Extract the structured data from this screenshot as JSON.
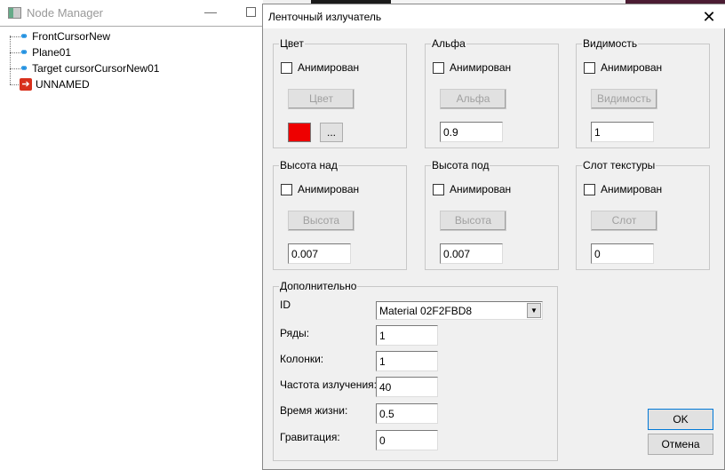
{
  "node_manager": {
    "title": "Node Manager",
    "items": [
      {
        "label": "FrontCursorNew",
        "icon": "bone-icon"
      },
      {
        "label": "Plane01",
        "icon": "bone-icon"
      },
      {
        "label": "Target cursorCursorNew01",
        "icon": "bone-icon"
      },
      {
        "label": "UNNAMED",
        "icon": "arrow-right-icon"
      }
    ]
  },
  "dialog": {
    "title": "Ленточный излучатель",
    "groups": {
      "color": {
        "title": "Цвет",
        "animated": "Анимирован",
        "button": "Цвет",
        "more": "...",
        "swatch": "#ee0000"
      },
      "alpha": {
        "title": "Альфа",
        "animated": "Анимирован",
        "button": "Альфа",
        "value": "0.9"
      },
      "visibility": {
        "title": "Видимость",
        "animated": "Анимирован",
        "button": "Видимость",
        "value": "1"
      },
      "height_above": {
        "title": "Высота над",
        "animated": "Анимирован",
        "button": "Высота",
        "value": "0.007"
      },
      "height_below": {
        "title": "Высота под",
        "animated": "Анимирован",
        "button": "Высота",
        "value": "0.007"
      },
      "texture_slot": {
        "title": "Слот текстуры",
        "animated": "Анимирован",
        "button": "Слот",
        "value": "0"
      }
    },
    "extra": {
      "title": "Дополнительно",
      "id_label": "ID",
      "id_value": "Material 02F2FBD8",
      "rows_label": "Ряды:",
      "rows": "1",
      "cols_label": "Колонки:",
      "cols": "1",
      "rate_label": "Частота излучения:",
      "rate": "40",
      "life_label": "Время жизни:",
      "life": "0.5",
      "gravity_label": "Гравитация:",
      "gravity": "0"
    },
    "ok": "OK",
    "cancel": "Отмена"
  }
}
